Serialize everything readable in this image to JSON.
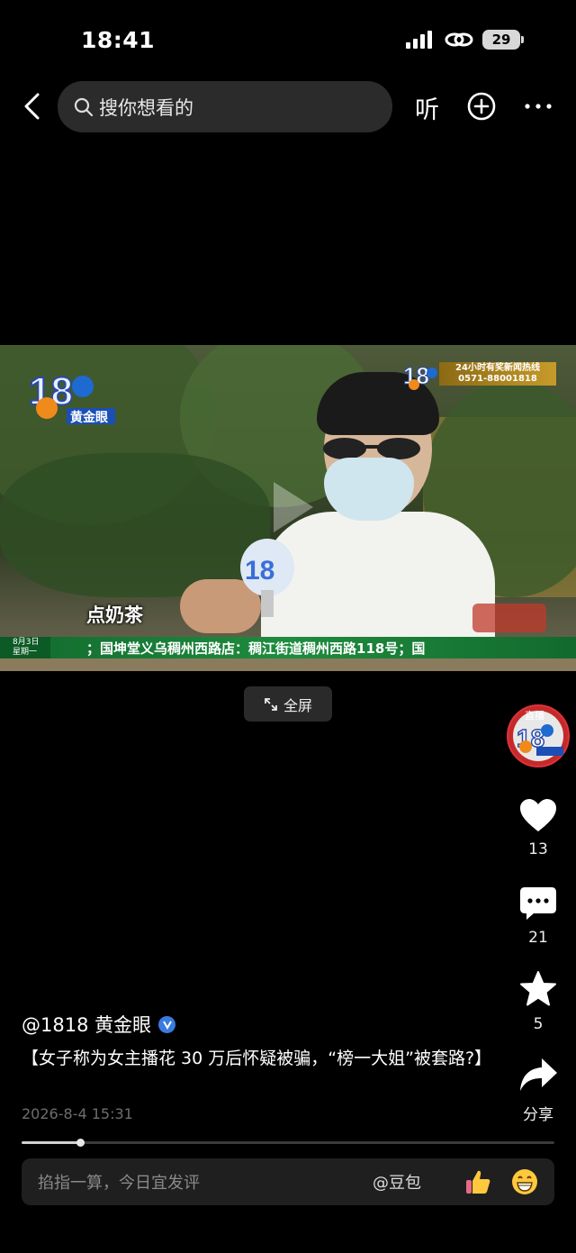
{
  "status_bar": {
    "time": "18:41",
    "battery": "29"
  },
  "top_bar": {
    "search_placeholder": "搜你想看的",
    "listen_label": "听"
  },
  "video": {
    "logo_text": "黄金眼",
    "hotline_line1": "24小时有奖新闻热线",
    "hotline_line2": "0571-88001818",
    "subtitle": "点奶茶",
    "ticker_date": "8月3日",
    "ticker_weekday": "星期一",
    "ticker_text": "；国坤堂义乌稠州西路店：稠江街道稠州西路118号；国",
    "fullscreen_label": "全屏"
  },
  "right_rail": {
    "live_label": "直播",
    "likes": "13",
    "comments": "21",
    "favorites": "5",
    "share_label": "分享"
  },
  "post": {
    "author": "@1818 黄金眼",
    "title": "【女子称为女主播花 30 万后怀疑被骗，“榜一大姐”被套路?】",
    "date": "2026-8-4 15:31",
    "progress_fraction": 0.11
  },
  "comment_bar": {
    "placeholder": "掐指一算，今日宜发评",
    "mention": "@豆包"
  },
  "icons": [
    "back-icon",
    "search-icon",
    "plus-circle-icon",
    "more-icon",
    "play-icon",
    "expand-icon",
    "heart-icon",
    "comment-icon",
    "star-icon",
    "share-icon",
    "verified-icon",
    "thumbs-up-icon",
    "grin-icon"
  ]
}
